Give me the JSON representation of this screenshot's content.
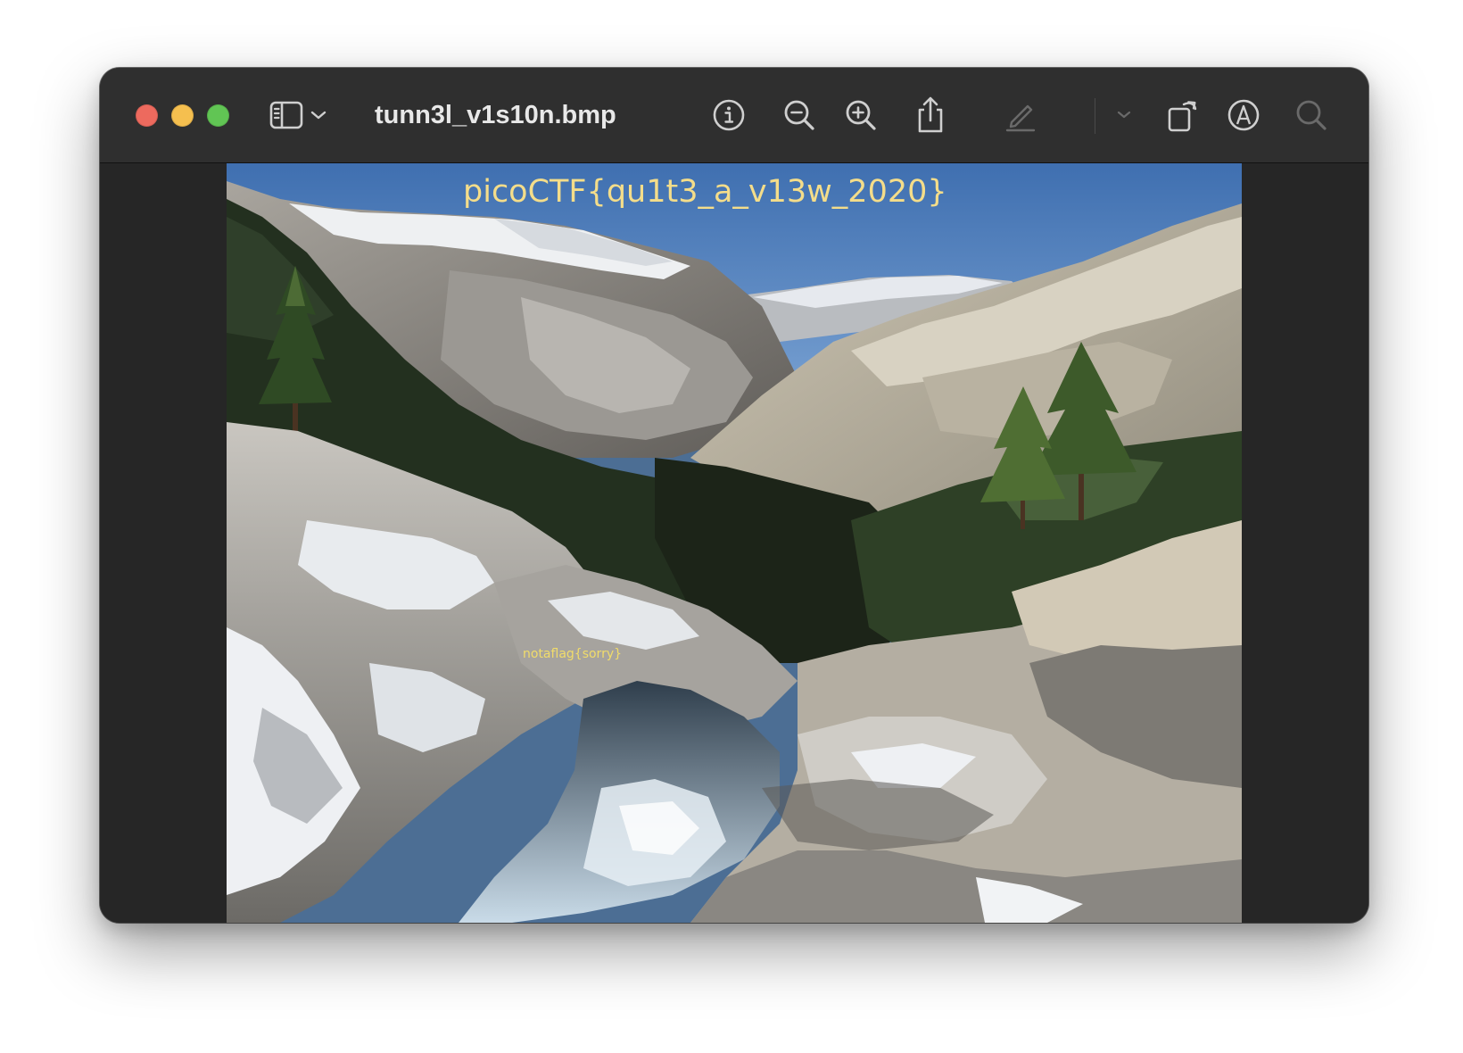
{
  "window": {
    "title": "tunn3l_v1s10n.bmp"
  },
  "toolbar": {
    "sidebar_toggle_icon": "sidebar-icon",
    "sidebar_menu_icon": "chevron-down-icon",
    "info_icon": "info-icon",
    "zoom_out_icon": "zoom-out-icon",
    "zoom_in_icon": "zoom-in-icon",
    "share_icon": "share-icon",
    "highlight_icon": "pencil-icon",
    "highlight_menu_icon": "chevron-down-icon",
    "rotate_icon": "rotate-icon",
    "markup_icon": "markup-icon",
    "search_icon": "search-icon"
  },
  "image": {
    "overlay_flag_text": "picoCTF{qu1t3_a_v13w_2020}",
    "overlay_small_text": "notaflag{sorry}"
  },
  "colors": {
    "traffic_close": "#ed6a5e",
    "traffic_minimize": "#f5bf4f",
    "traffic_maximize": "#61c554",
    "titlebar": "#2f2f2f",
    "content_bg": "#262626",
    "flag_text": "#f4dd8a",
    "small_text": "#f1dc6a"
  }
}
